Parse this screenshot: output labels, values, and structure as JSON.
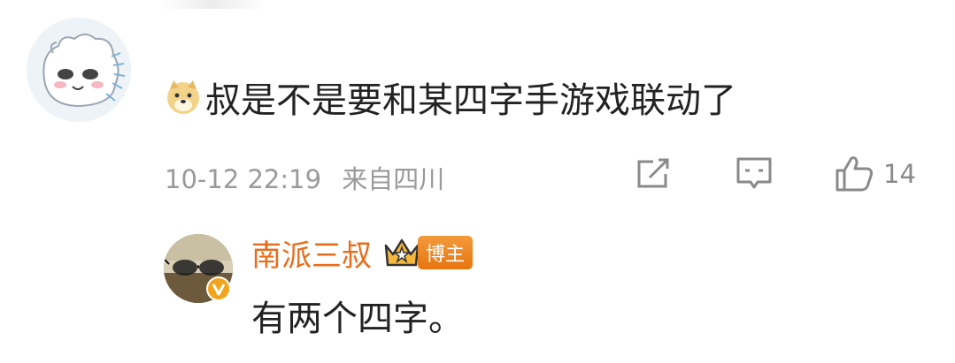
{
  "comment": {
    "text": "叔是不是要和某四字手游戏联动了",
    "emoji_icon": "doge-emoji-icon",
    "date": "10-12 22:19",
    "location": "来自四川",
    "like_count": "14"
  },
  "reply": {
    "author": "南派三叔",
    "badge": "博主",
    "text": "有两个四字。",
    "accent_color": "#e86d1a"
  },
  "colors": {
    "meta_text": "#9a9a9a",
    "body_text": "#222222",
    "badge_orange": "#f0891f",
    "verified_badge": "#f2a51c"
  }
}
